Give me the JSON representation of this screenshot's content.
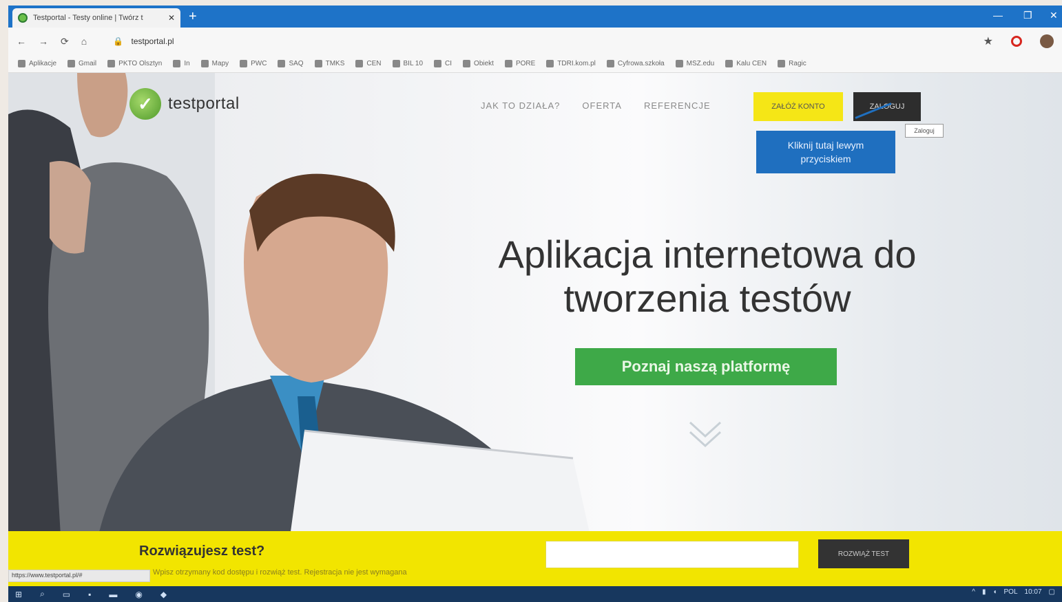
{
  "browser": {
    "tab_title": "Testportal - Testy online | Twórz t",
    "new_tab": "+",
    "url": "testportal.pl",
    "window_controls": {
      "minimize": "—",
      "maximize": "❐",
      "close": "✕"
    },
    "bookmarks": [
      "Aplikacje",
      "Gmail",
      "PKTO Olsztyn",
      "In",
      "Mapy",
      "PWC",
      "SAQ",
      "TMKS",
      "CEN",
      "BIL 10",
      "CI",
      "Obiekt",
      "PORE",
      "TDRI.kom.pl",
      "Cyfrowa.szkoła",
      "MSZ.edu",
      "Kalu CEN",
      "Ragic"
    ]
  },
  "site": {
    "logo_text": "testportal",
    "nav": [
      "JAK TO DZIAŁA?",
      "OFERTA",
      "REFERENCJE"
    ],
    "register_label": "ZAŁÓŻ KONTO",
    "login_label": "ZALOGUJ",
    "login_tooltip": "Zaloguj",
    "callout": "Kliknij tutaj lewym przyciskiem",
    "headline_line1": "Aplikacja internetowa do",
    "headline_line2": "tworzenia testów",
    "cta_label": "Poznaj naszą platformę",
    "colors": {
      "yellow": "#f2e500",
      "green": "#3ea948",
      "callout_blue": "#1f6fbf",
      "tabbar_blue": "#1e73c8"
    }
  },
  "testbar": {
    "title": "Rozwiązujesz test?",
    "subtitle": "Wpisz otrzymany kod dostępu i rozwiąż test. Rejestracja nie jest wymagana",
    "code_value": "",
    "solve_label": "ROZWIĄŻ TEST",
    "status_url": "https://www.testportal.pl/#"
  },
  "taskbar": {
    "time": "10:07",
    "lang": "POL"
  }
}
